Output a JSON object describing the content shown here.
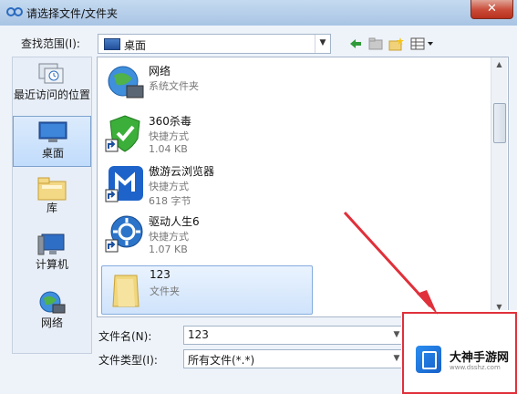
{
  "window": {
    "title": "请选择文件/文件夹",
    "close_label": "✕"
  },
  "lookin": {
    "label": "查找范围(I):",
    "value": "桌面"
  },
  "toolbar": {
    "icons": [
      "back-icon",
      "up-folder-icon",
      "new-folder-icon",
      "view-menu-icon"
    ]
  },
  "places": [
    {
      "label": "最近访问的位置",
      "icon": "recent-places-icon"
    },
    {
      "label": "桌面",
      "icon": "desktop-icon",
      "selected": true
    },
    {
      "label": "库",
      "icon": "libraries-icon"
    },
    {
      "label": "计算机",
      "icon": "computer-icon"
    },
    {
      "label": "网络",
      "icon": "network-icon"
    }
  ],
  "files": [
    {
      "name": "网络",
      "type": "系统文件夹",
      "size": "",
      "icon": "network-icon"
    },
    {
      "name": "360杀毒",
      "type": "快捷方式",
      "size": "1.04 KB",
      "icon": "360-antivirus-shortcut-icon"
    },
    {
      "name": "傲游云浏览器",
      "type": "快捷方式",
      "size": "618 字节",
      "icon": "maxthon-browser-shortcut-icon"
    },
    {
      "name": "驱动人生6",
      "type": "快捷方式",
      "size": "1.07 KB",
      "icon": "driver-life-shortcut-icon"
    },
    {
      "name": "123",
      "type": "文件夹",
      "size": "",
      "icon": "folder-icon",
      "selected": true
    }
  ],
  "filename": {
    "label": "文件名(N):",
    "value": "123"
  },
  "filetype": {
    "label": "文件类型(I):",
    "value": "所有文件(*.*)"
  },
  "watermark": {
    "name": "大神手游网",
    "sub": "www.dsshz.com"
  },
  "colors": {
    "annotation_arrow": "#e0303a",
    "selection": "#cfe3fb"
  }
}
